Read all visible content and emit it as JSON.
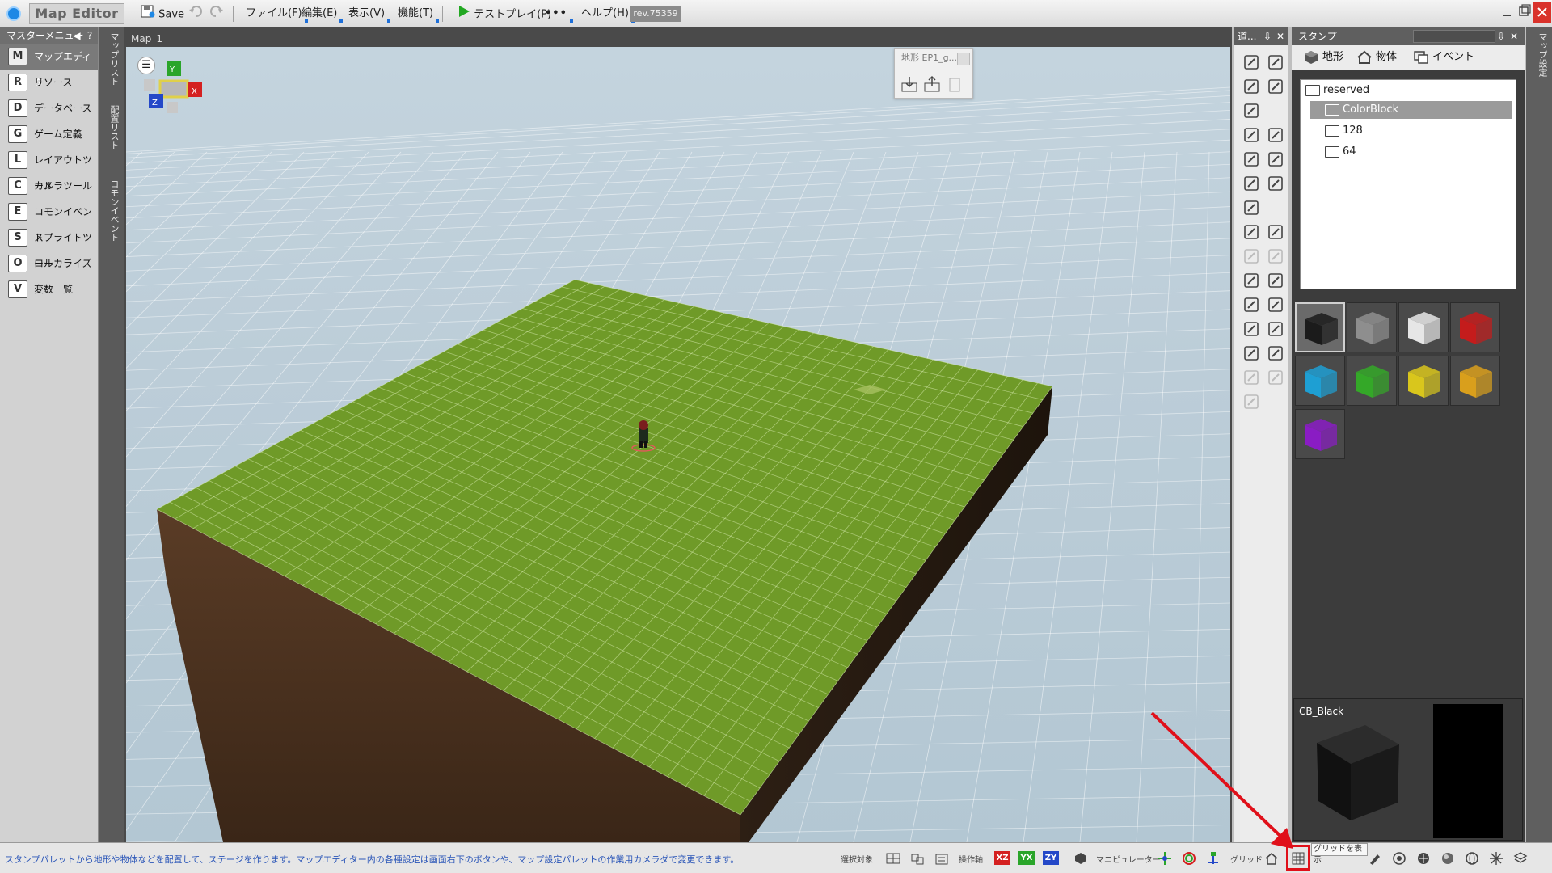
{
  "app": {
    "title": "Map Editor",
    "save_label": "Save",
    "menus": [
      "ファイル(F)",
      "編集(E)",
      "表示(V)",
      "機能(T)"
    ],
    "testplay_label": "テストプレイ(P)",
    "more_label": "•••",
    "help_label": "ヘルプ(H)",
    "revision": "rev.75359"
  },
  "master_menu": {
    "title": "マスターメニュー",
    "help": "?",
    "items": [
      {
        "label": "マップエディター",
        "icon": "M"
      },
      {
        "label": "リソース",
        "icon": "R"
      },
      {
        "label": "データベース",
        "icon": "D"
      },
      {
        "label": "ゲーム定義",
        "icon": "G"
      },
      {
        "label": "レイアウトツール",
        "icon": "L"
      },
      {
        "label": "カメラツール",
        "icon": "C"
      },
      {
        "label": "コモンイベント",
        "icon": "E"
      },
      {
        "label": "スプライトツール",
        "icon": "S"
      },
      {
        "label": "ローカライズ",
        "icon": "O"
      },
      {
        "label": "変数一覧",
        "icon": "V"
      }
    ],
    "active_index": 0
  },
  "vertical_tabs": [
    "マップリスト",
    "配置リスト",
    "コモンイベント"
  ],
  "viewport": {
    "tab_label": "Map_1",
    "gizmo_labels": {
      "x": "X",
      "y": "Y",
      "z": "Z"
    },
    "stamp_popup_title": "地形 EP1_g..."
  },
  "tools_panel": {
    "title": "道...",
    "pin": "⇩",
    "close": "✕"
  },
  "stamp_panel": {
    "title": "スタンプ",
    "tabs": [
      "地形",
      "物体",
      "イベント"
    ],
    "tree": [
      {
        "label": "reserved",
        "level": 0
      },
      {
        "label": "ColorBlock",
        "level": 1,
        "selected": true
      },
      {
        "label": "128",
        "level": 1
      },
      {
        "label": "64",
        "level": 1
      }
    ],
    "swatches": [
      {
        "name": "black",
        "color": "#1b1b1b",
        "selected": true
      },
      {
        "name": "gray",
        "color": "#8e8e8e"
      },
      {
        "name": "white",
        "color": "#e6e6e6"
      },
      {
        "name": "red",
        "color": "#c41c1c"
      },
      {
        "name": "cyan",
        "color": "#1e9fd3"
      },
      {
        "name": "green",
        "color": "#34a828"
      },
      {
        "name": "yellow",
        "color": "#d9c61c"
      },
      {
        "name": "orange",
        "color": "#d99f1c"
      },
      {
        "name": "purple",
        "color": "#8a1cc4"
      }
    ],
    "preview_name": "CB_Black"
  },
  "right_strip_label": "マップ設定",
  "statusbar": {
    "hint": "スタンプパレットから地形や物体などを配置して、ステージを作ります。マップエディター内の各種設定は画面右下のボタンや、マップ設定パレットの作業用カメラダで変更できます。",
    "selection_target": "選択対象",
    "operation_axis": "操作軸",
    "axes": [
      "XZ",
      "YX",
      "ZY"
    ],
    "manipulator": "マニピュレーター",
    "grid": "グリッド",
    "tooltip": "グリッドを表示"
  },
  "colors": {
    "ground_top": "#6f9a28",
    "ground_side": "#4a3220",
    "sky": "#c0d0db",
    "highlight": "#e0101a",
    "axis_x": "#d42020",
    "axis_y": "#2aa52a",
    "axis_z": "#2448c8"
  }
}
